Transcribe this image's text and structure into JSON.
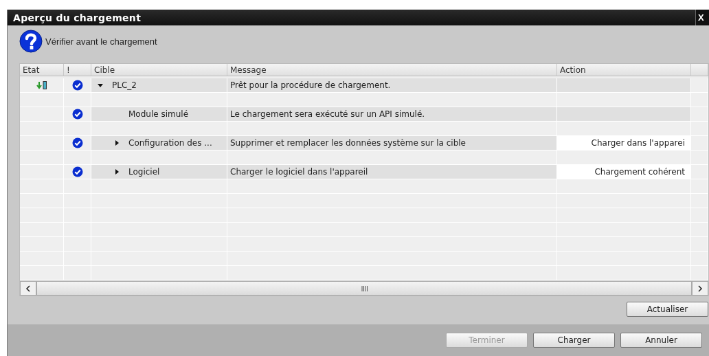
{
  "window": {
    "title": "Aperçu du chargement",
    "close": "X"
  },
  "header": {
    "text": "Vérifier avant le chargement"
  },
  "table": {
    "columns": [
      "Etat",
      "!",
      "Cible",
      "Message",
      "Action"
    ],
    "rows": [
      {
        "kind": "device",
        "ok": true,
        "target": "PLC_2",
        "expanded": true,
        "message": "Prêt pour la procédure de chargement.",
        "children": [
          {
            "ok": true,
            "target": "Module simulé",
            "message": "Le chargement sera exécuté sur un API simulé."
          },
          {
            "ok": true,
            "target": "Configuration des ...",
            "expanded": false,
            "message": "Supprimer et remplacer les données système sur la cible",
            "action": "Charger dans l'apparei"
          },
          {
            "ok": true,
            "target": "Logiciel",
            "expanded": false,
            "message": "Charger le logiciel dans l'appareil",
            "action": "Chargement cohérent"
          }
        ]
      }
    ]
  },
  "refresh_button": {
    "label": "Actualiser"
  },
  "buttons": [
    {
      "label": "Terminer",
      "disabled": true
    },
    {
      "label": "Charger",
      "disabled": false
    },
    {
      "label": "Annuler",
      "disabled": false
    }
  ]
}
